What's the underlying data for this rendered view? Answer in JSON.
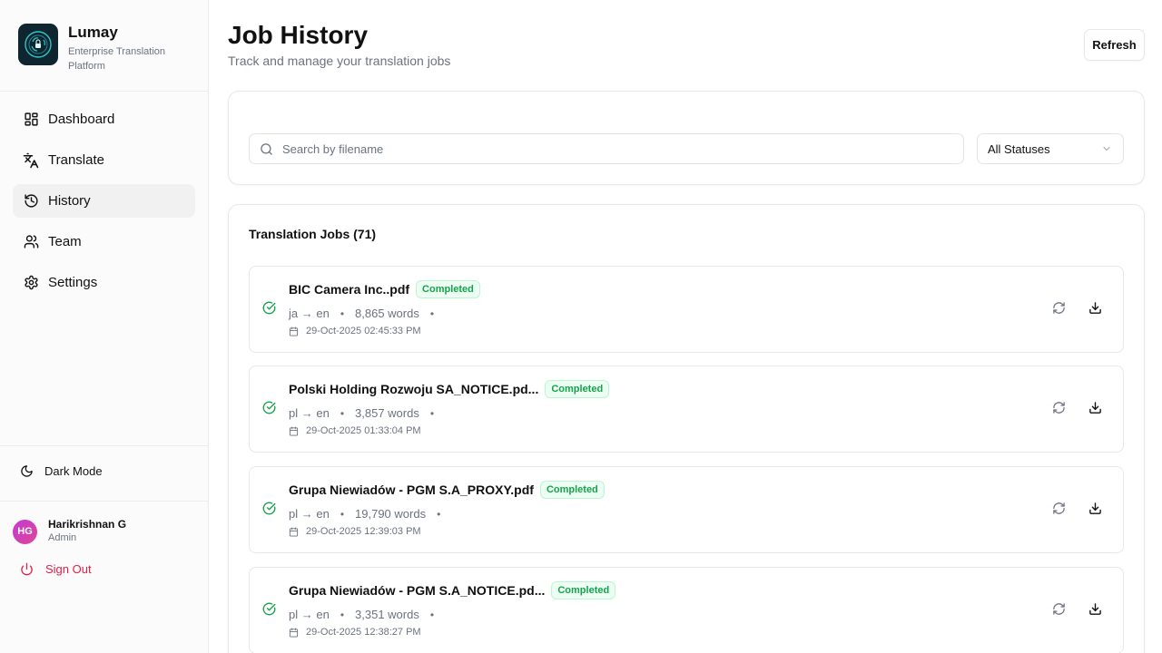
{
  "brand": {
    "name": "Lumay",
    "subtitle": "Enterprise Translation Platform",
    "logo_icon": "lumay-logo"
  },
  "nav": {
    "items": [
      {
        "label": "Dashboard",
        "icon": "dashboard-grid-icon",
        "active": false
      },
      {
        "label": "Translate",
        "icon": "translate-icon",
        "active": false
      },
      {
        "label": "History",
        "icon": "history-icon",
        "active": true
      },
      {
        "label": "Team",
        "icon": "team-icon",
        "active": false
      },
      {
        "label": "Settings",
        "icon": "gear-icon",
        "active": false
      }
    ]
  },
  "sidebar_footer": {
    "dark_mode_label": "Dark Mode",
    "user": {
      "initials": "HG",
      "name": "Harikrishnan G",
      "role": "Admin"
    },
    "sign_out_label": "Sign Out"
  },
  "header": {
    "title": "Job History",
    "subtitle": "Track and manage your translation jobs",
    "refresh_label": "Refresh"
  },
  "filters": {
    "search_placeholder": "Search by filename",
    "search_value": "",
    "status_selected": "All Statuses"
  },
  "jobs": {
    "title": "Translation Jobs (71)",
    "items": [
      {
        "filename": "BIC Camera Inc..pdf",
        "status": "Completed",
        "langs": "ja → en",
        "words": "8,865 words",
        "date": "29-Oct-2025 02:45:33 PM"
      },
      {
        "filename": "Polski Holding Rozwoju SA_NOTICE.pd...",
        "status": "Completed",
        "langs": "pl → en",
        "words": "3,857 words",
        "date": "29-Oct-2025 01:33:04 PM"
      },
      {
        "filename": "Grupa Niewiadów - PGM S.A_PROXY.pdf",
        "status": "Completed",
        "langs": "pl → en",
        "words": "19,790 words",
        "date": "29-Oct-2025 12:39:03 PM"
      },
      {
        "filename": "Grupa Niewiadów - PGM S.A_NOTICE.pd...",
        "status": "Completed",
        "langs": "pl → en",
        "words": "3,351 words",
        "date": "29-Oct-2025 12:38:27 PM"
      }
    ]
  },
  "colors": {
    "accent_red": "#e11d48",
    "status_green": "#16a34a",
    "active_nav_bg": "#f1f1f1"
  }
}
